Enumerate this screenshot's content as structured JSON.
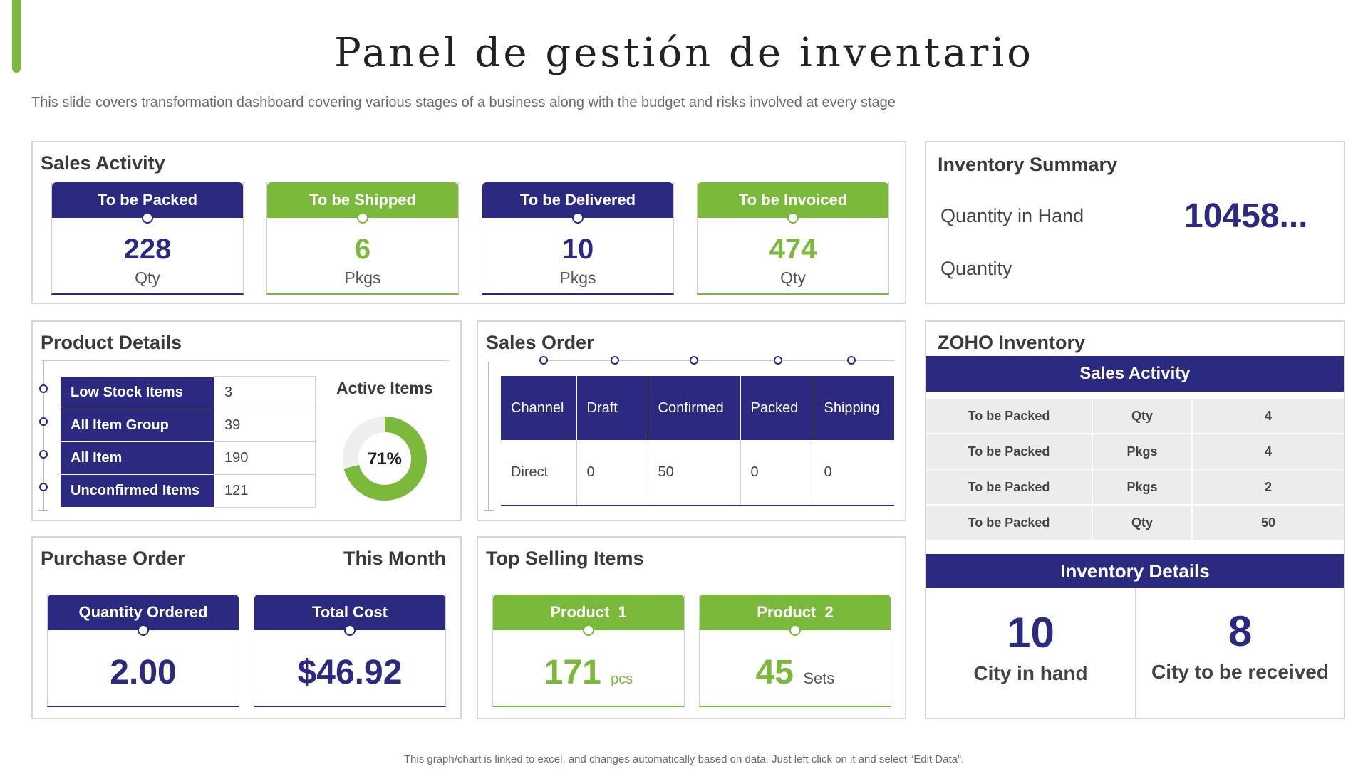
{
  "header": {
    "title": "Panel de gestión de inventario",
    "subtitle": "This slide covers transformation dashboard covering various stages of a business along with the budget and risks involved at every stage"
  },
  "sales_activity": {
    "title": "Sales Activity",
    "cards": [
      {
        "label": "To be Packed",
        "value": "228",
        "unit": "Qty",
        "color": "#2b2a80"
      },
      {
        "label": "To be Shipped",
        "value": "6",
        "unit": "Pkgs",
        "color": "#7ab93a"
      },
      {
        "label": "To be Delivered",
        "value": "10",
        "unit": "Pkgs",
        "color": "#2b2a80"
      },
      {
        "label": "To be Invoiced",
        "value": "474",
        "unit": "Qty",
        "color": "#7ab93a"
      }
    ]
  },
  "inventory_summary": {
    "title": "Inventory Summary",
    "quantity_in_hand_label": "Quantity in Hand",
    "quantity_in_hand_value": "10458...",
    "quantity_label": "Quantity"
  },
  "product_details": {
    "title": "Product Details",
    "rows": [
      {
        "label": "Low Stock Items",
        "value": "3"
      },
      {
        "label": "All Item Group",
        "value": "39"
      },
      {
        "label": "All Item",
        "value": "190"
      },
      {
        "label": "Unconfirmed Items",
        "value": "121"
      }
    ],
    "active_items_label": "Active Items",
    "active_items_percent": 71,
    "active_items_text": "71%"
  },
  "sales_order": {
    "title": "Sales Order",
    "headers": [
      "Channel",
      "Draft",
      "Confirmed",
      "Packed",
      "Shipping"
    ],
    "row": [
      "Direct",
      "0",
      "50",
      "0",
      "0"
    ]
  },
  "zoho": {
    "title": "ZOHO Inventory",
    "band_label": "Sales Activity",
    "rows": [
      {
        "label": "To be Packed",
        "unit": "Qty",
        "value": "4"
      },
      {
        "label": "To be Packed",
        "unit": "Pkgs",
        "value": "4"
      },
      {
        "label": "To be Packed",
        "unit": "Pkgs",
        "value": "2"
      },
      {
        "label": "To be Packed",
        "unit": "Qty",
        "value": "50"
      }
    ],
    "details_label": "Inventory Details",
    "city_in_hand_value": "10",
    "city_in_hand_label": "City in hand",
    "city_to_receive_value": "8",
    "city_to_receive_label": "City to be received"
  },
  "purchase_order": {
    "title": "Purchase Order",
    "period": "This Month",
    "cards": [
      {
        "label": "Quantity Ordered",
        "value": "2.00"
      },
      {
        "label": "Total Cost",
        "value": "$46.92"
      }
    ]
  },
  "top_selling": {
    "title": "Top Selling Items",
    "items": [
      {
        "label": "Product  1",
        "value": "171",
        "unit": "pcs"
      },
      {
        "label": "Product  2",
        "value": "45",
        "unit": "Sets"
      }
    ]
  },
  "footer": {
    "note": "This graph/chart is linked to excel, and changes automatically based on data. Just left click on it and select “Edit Data”."
  },
  "colors": {
    "navy": "#2b2a80",
    "green": "#7ab93a"
  }
}
